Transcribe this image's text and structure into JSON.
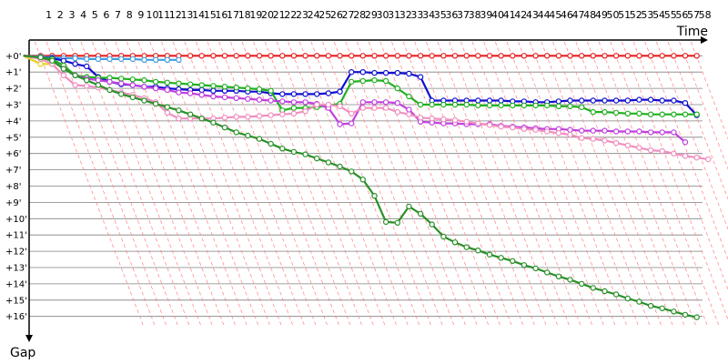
{
  "chart_data": {
    "type": "line",
    "xlabel": "Time",
    "ylabel": "Gap",
    "laps": [
      1,
      2,
      3,
      4,
      5,
      6,
      7,
      8,
      9,
      10,
      11,
      12,
      13,
      14,
      15,
      16,
      17,
      18,
      19,
      20,
      21,
      22,
      23,
      24,
      25,
      26,
      27,
      28,
      29,
      30,
      31,
      32,
      33,
      34,
      35,
      36,
      37,
      38,
      39,
      40,
      41,
      42,
      43,
      44,
      45,
      46,
      47,
      48,
      49,
      50,
      51,
      52,
      53,
      54,
      55,
      56,
      57,
      58
    ],
    "gap_ticks": [
      "+0'",
      "+1'",
      "+2'",
      "+3'",
      "+4'",
      "+5'",
      "+6'",
      "+7'",
      "+8'",
      "+9'",
      "+10'",
      "+11'",
      "+12'",
      "+13'",
      "+14'",
      "+15'",
      "+16'"
    ],
    "ylim": [
      0,
      17
    ],
    "grid": true,
    "colors": {
      "axis": "#000000",
      "grid": "#808080",
      "diag": "#ff8080"
    },
    "series": [
      {
        "color": "#e82020",
        "start": 1,
        "lap0": -0.5,
        "y0": 0.0,
        "values": [
          0.0,
          0.0,
          0.0,
          0.0,
          0.0,
          0.0,
          0.0,
          0.0,
          0.0,
          0.0,
          0.0,
          0.0,
          0.0,
          0.0,
          0.0,
          0.0,
          0.0,
          0.0,
          0.0,
          0.0,
          0.0,
          0.0,
          0.0,
          0.0,
          0.0,
          0.0,
          0.0,
          0.0,
          0.0,
          0.0,
          0.0,
          0.0,
          0.0,
          0.0,
          0.0,
          0.0,
          0.0,
          0.0,
          0.0,
          0.0,
          0.0,
          0.0,
          0.0,
          0.0,
          0.0,
          0.0,
          0.0,
          0.0,
          0.0,
          0.0,
          0.0,
          0.0,
          0.0,
          0.0,
          0.0,
          0.0,
          0.0,
          0.0
        ]
      },
      {
        "color": "#40a0e0",
        "start": 1,
        "lap0": -0.5,
        "y0": 0.0,
        "values": [
          0.05,
          0.1,
          0.15,
          0.15,
          0.2,
          0.2,
          0.2,
          0.2,
          0.2,
          0.25,
          0.25,
          0.25,
          0.25
        ]
      },
      {
        "color": "#e8d020",
        "start": 1,
        "lap0": -0.5,
        "y0": 0.0,
        "values": [
          0.5,
          0.5
        ]
      },
      {
        "color": "#1010d0",
        "start": 1,
        "lap0": -0.5,
        "y0": 0.0,
        "values": [
          0.1,
          0.15,
          0.3,
          0.5,
          0.65,
          1.3,
          1.6,
          1.75,
          1.8,
          1.9,
          1.9,
          2.0,
          2.05,
          2.1,
          2.1,
          2.15,
          2.15,
          2.15,
          2.2,
          2.2,
          2.3,
          2.35,
          2.35,
          2.35,
          2.35,
          2.3,
          2.2,
          1.0,
          1.0,
          1.05,
          1.05,
          1.05,
          1.1,
          1.3,
          2.75,
          2.75,
          2.75,
          2.75,
          2.75,
          2.75,
          2.75,
          2.8,
          2.8,
          2.85,
          2.85,
          2.8,
          2.75,
          2.75,
          2.75,
          2.75,
          2.75,
          2.75,
          2.7,
          2.7,
          2.75,
          2.75,
          2.9,
          3.65
        ]
      },
      {
        "color": "#20b020",
        "start": 1,
        "lap0": -0.5,
        "y0": 0.0,
        "values": [
          0.1,
          0.2,
          0.6,
          1.2,
          1.3,
          1.35,
          1.35,
          1.4,
          1.45,
          1.5,
          1.6,
          1.65,
          1.7,
          1.75,
          1.8,
          1.85,
          1.9,
          1.95,
          2.0,
          2.05,
          2.15,
          3.35,
          3.2,
          3.2,
          3.15,
          3.05,
          2.95,
          1.6,
          1.55,
          1.5,
          1.55,
          2.0,
          2.5,
          3.0,
          3.0,
          3.0,
          3.0,
          3.0,
          3.05,
          3.05,
          3.05,
          3.05,
          3.05,
          3.05,
          3.05,
          3.1,
          3.1,
          3.15,
          3.45,
          3.45,
          3.5,
          3.55,
          3.55,
          3.6,
          3.6,
          3.6,
          3.6,
          3.6
        ]
      },
      {
        "color": "#c040e0",
        "start": 1,
        "lap0": -0.5,
        "y0": 0.0,
        "values": [
          0.1,
          0.3,
          0.8,
          1.2,
          1.4,
          1.5,
          1.6,
          1.7,
          1.8,
          1.9,
          2.0,
          2.1,
          2.25,
          2.3,
          2.4,
          2.5,
          2.55,
          2.6,
          2.65,
          2.7,
          2.75,
          2.8,
          2.85,
          2.85,
          2.95,
          3.2,
          4.2,
          4.15,
          2.85,
          2.85,
          2.85,
          2.9,
          3.3,
          4.05,
          4.1,
          4.15,
          4.15,
          4.2,
          4.2,
          4.2,
          4.3,
          4.35,
          4.4,
          4.45,
          4.5,
          4.5,
          4.55,
          4.6,
          4.6,
          4.6,
          4.65,
          4.65,
          4.65,
          4.7,
          4.7,
          4.7,
          5.3
        ]
      },
      {
        "color": "#f090c0",
        "start": 1,
        "lap0": -0.5,
        "y0": 0.0,
        "values": [
          0.2,
          0.5,
          1.2,
          1.8,
          1.85,
          1.95,
          2.1,
          2.25,
          2.4,
          2.6,
          2.85,
          3.5,
          3.85,
          3.85,
          3.85,
          3.85,
          3.8,
          3.75,
          3.75,
          3.7,
          3.65,
          3.6,
          3.55,
          3.4,
          3.0,
          3.0,
          3.1,
          3.55,
          3.2,
          3.2,
          3.2,
          3.45,
          3.6,
          3.8,
          3.85,
          3.9,
          3.95,
          4.05,
          4.15,
          4.25,
          4.35,
          4.4,
          4.5,
          4.55,
          4.65,
          4.75,
          4.85,
          5.05,
          5.1,
          5.2,
          5.35,
          5.5,
          5.65,
          5.8,
          5.85,
          6.0,
          6.15,
          6.25,
          6.35
        ]
      },
      {
        "color": "#289028",
        "start": 1,
        "lap0": -0.5,
        "y0": 0.0,
        "values": [
          0.1,
          0.3,
          0.8,
          1.2,
          1.5,
          1.8,
          2.1,
          2.35,
          2.55,
          2.75,
          2.95,
          3.15,
          3.35,
          3.6,
          3.85,
          4.1,
          4.4,
          4.7,
          4.9,
          5.1,
          5.4,
          5.7,
          5.9,
          6.05,
          6.3,
          6.55,
          6.8,
          7.1,
          7.6,
          8.6,
          10.2,
          10.25,
          9.25,
          9.7,
          10.35,
          11.1,
          11.45,
          11.75,
          11.95,
          12.2,
          12.4,
          12.6,
          12.85,
          13.05,
          13.3,
          13.55,
          13.75,
          14.0,
          14.25,
          14.45,
          14.65,
          14.9,
          15.1,
          15.35,
          15.5,
          15.7,
          15.9,
          16.05
        ]
      }
    ]
  }
}
